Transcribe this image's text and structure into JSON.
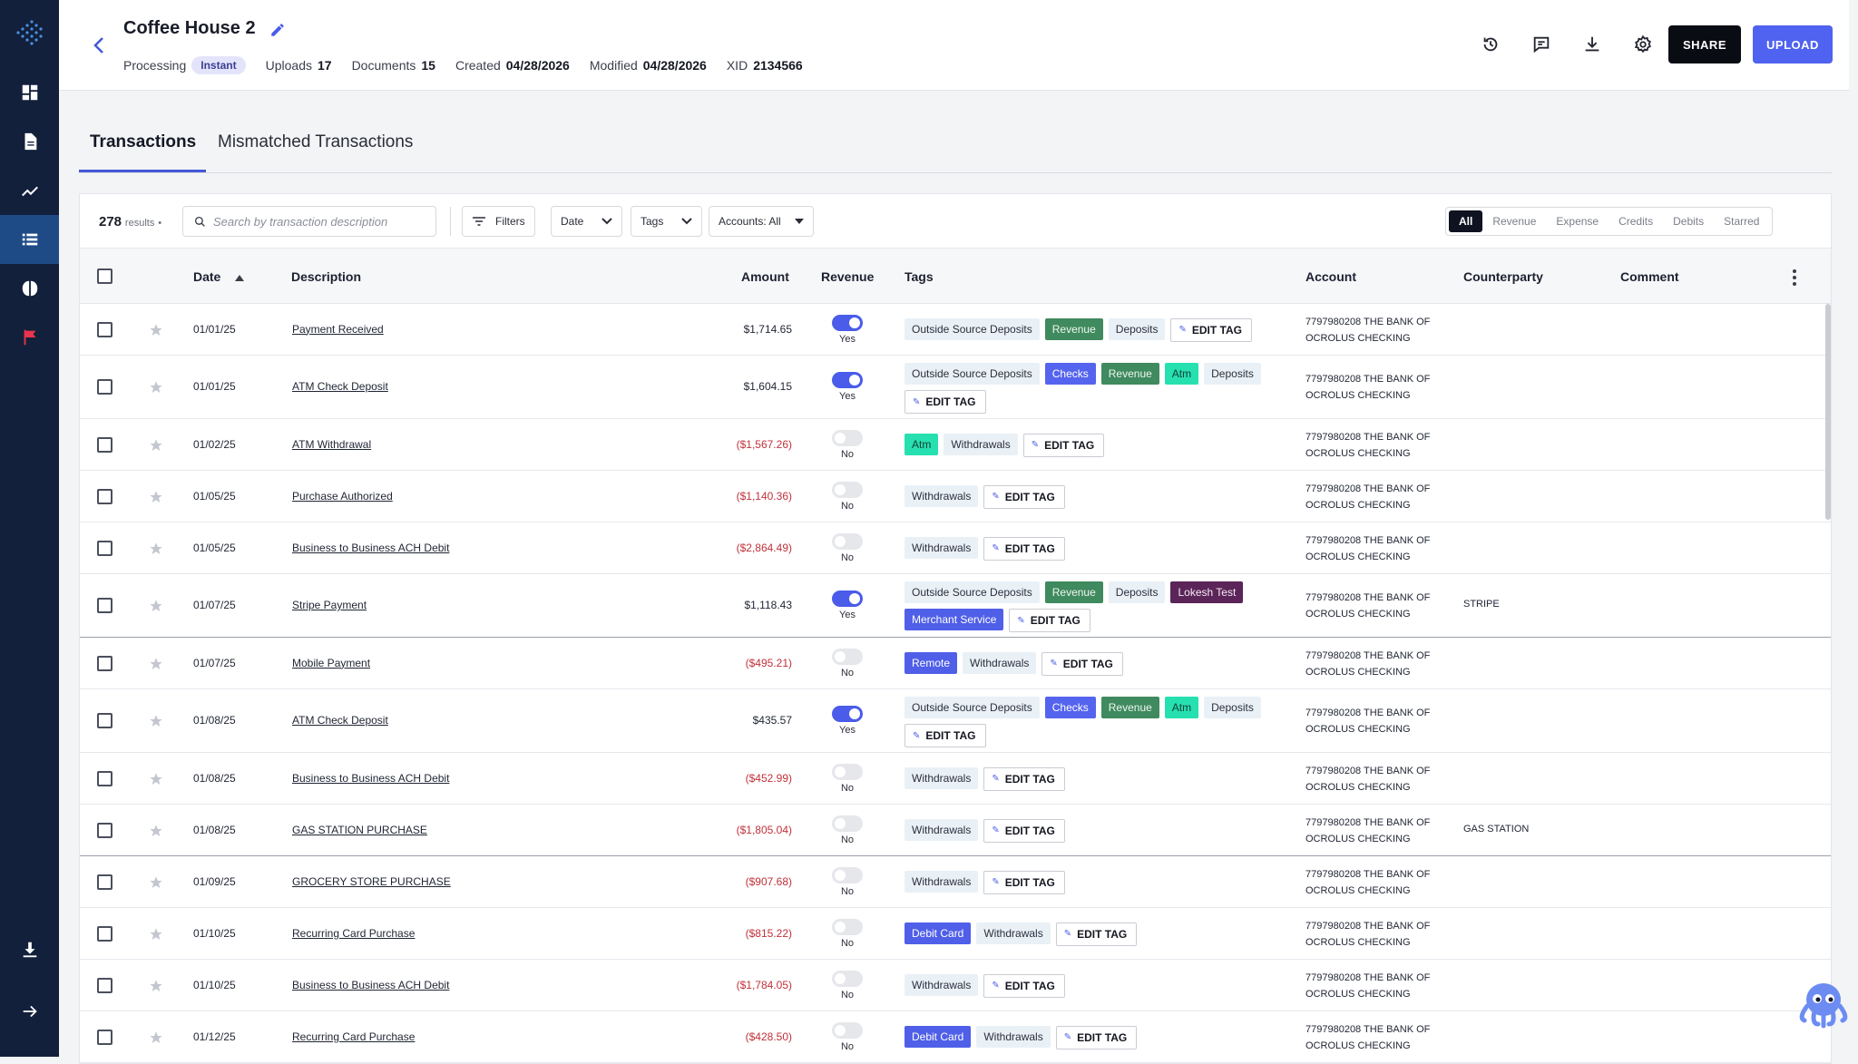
{
  "header": {
    "title": "Coffee House 2",
    "processing_label": "Processing",
    "processing_badge": "Instant",
    "uploads_label": "Uploads",
    "uploads_value": "17",
    "documents_label": "Documents",
    "documents_value": "15",
    "created_label": "Created",
    "created_value": "04/28/2026",
    "modified_label": "Modified",
    "modified_value": "04/28/2026",
    "xid_label": "XID",
    "xid_value": "2134566",
    "share_label": "SHARE",
    "upload_label": "UPLOAD"
  },
  "tabs": [
    {
      "label": "Transactions",
      "active": true
    },
    {
      "label": "Mismatched Transactions",
      "active": false
    }
  ],
  "toolbar": {
    "results_count": "278",
    "results_label": "results",
    "search_placeholder": "Search by transaction description",
    "filters_label": "Filters",
    "date_label": "Date",
    "tags_label": "Tags",
    "accounts_label": "Accounts: All",
    "segments": [
      "All",
      "Revenue",
      "Expense",
      "Credits",
      "Debits",
      "Starred"
    ]
  },
  "columns": {
    "date": "Date",
    "description": "Description",
    "amount": "Amount",
    "revenue": "Revenue",
    "tags": "Tags",
    "account": "Account",
    "counterparty": "Counterparty",
    "comment": "Comment"
  },
  "edit_tag_label": "EDIT TAG",
  "rows": [
    {
      "date": "01/01/25",
      "description": "Payment Received",
      "amount": "$1,714.65",
      "revenue": true,
      "revenue_label": "Yes",
      "tags": [
        {
          "t": "Outside Source Deposits",
          "k": "plain"
        },
        {
          "t": "Revenue",
          "k": "revenue"
        },
        {
          "t": "Deposits",
          "k": "plain"
        }
      ],
      "account": "7797980208 THE BANK OF OCROLUS CHECKING",
      "counterparty": ""
    },
    {
      "date": "01/01/25",
      "description": "ATM Check Deposit",
      "amount": "$1,604.15",
      "revenue": true,
      "revenue_label": "Yes",
      "tags": [
        {
          "t": "Outside Source Deposits",
          "k": "plain"
        },
        {
          "t": "Checks",
          "k": "checks"
        },
        {
          "t": "Revenue",
          "k": "revenue"
        },
        {
          "t": "Atm",
          "k": "atm"
        },
        {
          "t": "Deposits",
          "k": "plain"
        }
      ],
      "account": "7797980208 THE BANK OF OCROLUS CHECKING",
      "counterparty": ""
    },
    {
      "date": "01/02/25",
      "description": "ATM Withdrawal",
      "amount": "($1,567.26)",
      "revenue": false,
      "revenue_label": "No",
      "tags": [
        {
          "t": "Atm",
          "k": "atm"
        },
        {
          "t": "Withdrawals",
          "k": "plain"
        }
      ],
      "account": "7797980208 THE BANK OF OCROLUS CHECKING",
      "counterparty": ""
    },
    {
      "date": "01/05/25",
      "description": "Purchase Authorized",
      "amount": "($1,140.36)",
      "revenue": false,
      "revenue_label": "No",
      "tags": [
        {
          "t": "Withdrawals",
          "k": "plain"
        }
      ],
      "account": "7797980208 THE BANK OF OCROLUS CHECKING",
      "counterparty": ""
    },
    {
      "date": "01/05/25",
      "description": "Business to Business ACH Debit",
      "amount": "($2,864.49)",
      "revenue": false,
      "revenue_label": "No",
      "tags": [
        {
          "t": "Withdrawals",
          "k": "plain"
        }
      ],
      "account": "7797980208 THE BANK OF OCROLUS CHECKING",
      "counterparty": ""
    },
    {
      "date": "01/07/25",
      "description": "Stripe Payment",
      "amount": "$1,118.43",
      "revenue": true,
      "revenue_label": "Yes",
      "tags": [
        {
          "t": "Outside Source Deposits",
          "k": "plain"
        },
        {
          "t": "Revenue",
          "k": "revenue"
        },
        {
          "t": "Deposits",
          "k": "plain"
        },
        {
          "t": "Lokesh Test",
          "k": "lokesh"
        },
        {
          "t": "Merchant Service",
          "k": "blue"
        }
      ],
      "account": "7797980208 THE BANK OF OCROLUS CHECKING",
      "counterparty": "STRIPE"
    },
    {
      "date": "01/07/25",
      "description": "Mobile Payment",
      "amount": "($495.21)",
      "revenue": false,
      "revenue_label": "No",
      "tags": [
        {
          "t": "Remote",
          "k": "blue"
        },
        {
          "t": "Withdrawals",
          "k": "plain"
        }
      ],
      "account": "7797980208 THE BANK OF OCROLUS CHECKING",
      "counterparty": ""
    },
    {
      "date": "01/08/25",
      "description": "ATM Check Deposit",
      "amount": "$435.57",
      "revenue": true,
      "revenue_label": "Yes",
      "tags": [
        {
          "t": "Outside Source Deposits",
          "k": "plain"
        },
        {
          "t": "Checks",
          "k": "checks"
        },
        {
          "t": "Revenue",
          "k": "revenue"
        },
        {
          "t": "Atm",
          "k": "atm"
        },
        {
          "t": "Deposits",
          "k": "plain"
        }
      ],
      "account": "7797980208 THE BANK OF OCROLUS CHECKING",
      "counterparty": ""
    },
    {
      "date": "01/08/25",
      "description": "Business to Business ACH Debit",
      "amount": "($452.99)",
      "revenue": false,
      "revenue_label": "No",
      "tags": [
        {
          "t": "Withdrawals",
          "k": "plain"
        }
      ],
      "account": "7797980208 THE BANK OF OCROLUS CHECKING",
      "counterparty": ""
    },
    {
      "date": "01/08/25",
      "description": "GAS STATION PURCHASE",
      "amount": "($1,805.04)",
      "revenue": false,
      "revenue_label": "No",
      "tags": [
        {
          "t": "Withdrawals",
          "k": "plain"
        }
      ],
      "account": "7797980208 THE BANK OF OCROLUS CHECKING",
      "counterparty": "GAS STATION"
    },
    {
      "date": "01/09/25",
      "description": "GROCERY STORE PURCHASE",
      "amount": "($907.68)",
      "revenue": false,
      "revenue_label": "No",
      "tags": [
        {
          "t": "Withdrawals",
          "k": "plain"
        }
      ],
      "account": "7797980208 THE BANK OF OCROLUS CHECKING",
      "counterparty": ""
    },
    {
      "date": "01/10/25",
      "description": "Recurring Card Purchase",
      "amount": "($815.22)",
      "revenue": false,
      "revenue_label": "No",
      "tags": [
        {
          "t": "Debit Card",
          "k": "blue"
        },
        {
          "t": "Withdrawals",
          "k": "plain"
        }
      ],
      "account": "7797980208 THE BANK OF OCROLUS CHECKING",
      "counterparty": ""
    },
    {
      "date": "01/10/25",
      "description": "Business to Business ACH Debit",
      "amount": "($1,784.05)",
      "revenue": false,
      "revenue_label": "No",
      "tags": [
        {
          "t": "Withdrawals",
          "k": "plain"
        }
      ],
      "account": "7797980208 THE BANK OF OCROLUS CHECKING",
      "counterparty": ""
    },
    {
      "date": "01/12/25",
      "description": "Recurring Card Purchase",
      "amount": "($428.50)",
      "revenue": false,
      "revenue_label": "No",
      "tags": [
        {
          "t": "Debit Card",
          "k": "blue"
        },
        {
          "t": "Withdrawals",
          "k": "plain"
        }
      ],
      "account": "7797980208 THE BANK OF OCROLUS CHECKING",
      "counterparty": ""
    }
  ],
  "sidebar": {
    "items": [
      {
        "icon": "dashboard-icon"
      },
      {
        "icon": "document-icon"
      },
      {
        "icon": "analytics-icon"
      },
      {
        "icon": "list-icon",
        "active": true
      },
      {
        "icon": "brain-icon"
      },
      {
        "icon": "flag-icon"
      },
      {
        "icon": "download-icon"
      },
      {
        "icon": "arrow-right-icon"
      }
    ]
  },
  "colors": {
    "sidebar": "#13203b",
    "accent": "#4f62f0",
    "negative": "#c0313a",
    "revenue_tag": "#3f8a5e",
    "atm_tag": "#26e0b0"
  }
}
